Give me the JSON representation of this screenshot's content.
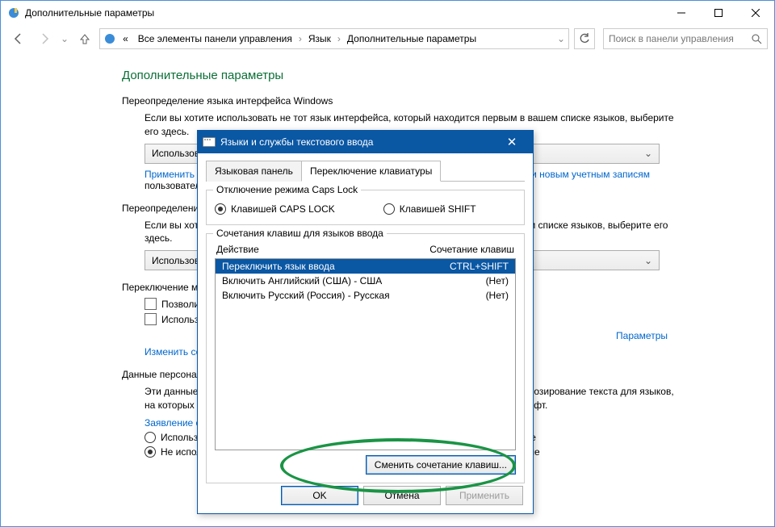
{
  "window": {
    "title": "Дополнительные параметры"
  },
  "breadcrumb": {
    "all": "Все элементы панели управления",
    "lang": "Язык",
    "adv": "Дополнительные параметры",
    "prefix": "«"
  },
  "search": {
    "placeholder": "Поиск в панели управления"
  },
  "page": {
    "title": "Дополнительные параметры",
    "sec1": "Переопределение языка интерфейса Windows",
    "sec1_body": "Если вы хотите использовать не тот язык интерфейса, который находится первым в вашем списке языков, выберите его здесь.",
    "combo1": "Использовать список языков (рекомендуется)",
    "link1a": "Применить языковые параметры к экрану приветствия, системным учетным записям и новым учетным записям",
    "link1a_tail": " пользователей",
    "sec2": "Переопределение метода ввода по умолчанию",
    "sec2_body": "Если вы хотите использовать не тот метод ввода, который находится первым в вашем списке языков, выберите его здесь.",
    "combo2": "Использовать список языков (рекомендуется)",
    "sec3": "Переключение методов ввода",
    "chk1": "Позволить выбирать метод ввода для каждого приложения",
    "chk2": "Использовать языковую панель, если она доступна",
    "link3": "Изменить сочетания клавиш языковой панели",
    "params_link": "Параметры",
    "sec4": "Данные персонализации",
    "sec4_body1": "Эти данные используются, чтобы улучшить распознавание рукописного ввода и прогнозирование текста для языков, на которых вы пишете. Эти данные хранятся на устройстве и в корпорацию Майкрософт.",
    "link4": "Заявление о конфиденциальности",
    "radio_a": "Использовать автоматическое обучение и сведения о вводе при рукописном вводе",
    "radio_b": "Не использовать автоматическое обучение и удалить все ранее собранные данные"
  },
  "dialog": {
    "title": "Языки и службы текстового ввода",
    "tab1": "Языковая панель",
    "tab2": "Переключение клавиатуры",
    "group1": "Отключение режима Caps Lock",
    "r_caps": "Клавишей CAPS LOCK",
    "r_shift": "Клавишей SHIFT",
    "group2": "Сочетания клавиш для языков ввода",
    "hdr_action": "Действие",
    "hdr_keys": "Сочетание клавиш",
    "rows": [
      {
        "action": "Переключить язык ввода",
        "keys": "CTRL+SHIFT"
      },
      {
        "action": "Включить Английский (США) - США",
        "keys": "(Нет)"
      },
      {
        "action": "Включить Русский (Россия) - Русская",
        "keys": "(Нет)"
      }
    ],
    "change_btn": "Сменить сочетание клавиш...",
    "ok": "OK",
    "cancel": "Отмена",
    "apply": "Применить"
  }
}
